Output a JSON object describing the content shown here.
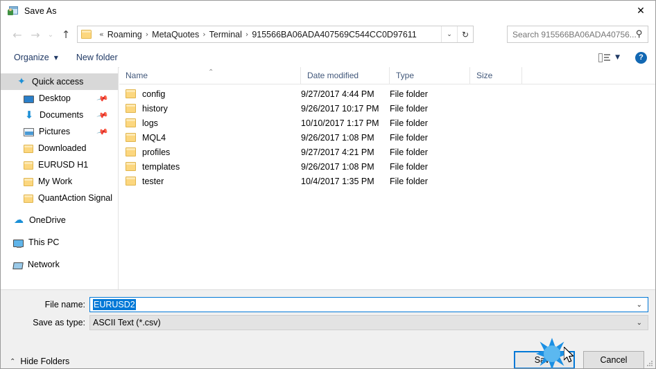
{
  "window": {
    "title": "Save As",
    "app_icon": "save-as-icon",
    "close_label": "✕"
  },
  "nav": {
    "back_label": "←",
    "forward_label": "→",
    "recent_label": "⌄",
    "up_label": "↑"
  },
  "address": {
    "folder_icon": "folder-icon",
    "prefix": "«",
    "crumbs": [
      "Roaming",
      "MetaQuotes",
      "Terminal",
      "915566BA06ADA407569C544CC0D97611"
    ],
    "separator": "›",
    "dropdown_label": "⌄",
    "refresh_label": "↻"
  },
  "search": {
    "placeholder": "Search 915566BA06ADA40756...",
    "icon": "search-icon"
  },
  "toolbar": {
    "organize_label": "Organize",
    "organize_caret": "▼",
    "new_folder_label": "New folder",
    "view_caret": "▼",
    "help_label": "?"
  },
  "sidebar": {
    "items": [
      {
        "label": "Quick access",
        "icon": "star-icon",
        "selected": true,
        "pinned": false,
        "indent": 22
      },
      {
        "label": "Desktop",
        "icon": "desktop-icon",
        "selected": false,
        "pinned": true,
        "indent": 33
      },
      {
        "label": "Documents",
        "icon": "download-arrow-icon",
        "selected": false,
        "pinned": true,
        "indent": 33
      },
      {
        "label": "Pictures",
        "icon": "pictures-icon",
        "selected": false,
        "pinned": true,
        "indent": 33
      },
      {
        "label": "Downloaded",
        "icon": "folder-icon",
        "selected": false,
        "pinned": false,
        "indent": 33
      },
      {
        "label": "EURUSD H1",
        "icon": "folder-icon",
        "selected": false,
        "pinned": false,
        "indent": 33
      },
      {
        "label": "My Work",
        "icon": "folder-icon",
        "selected": false,
        "pinned": false,
        "indent": 33
      },
      {
        "label": "QuantAction Signal",
        "icon": "folder-icon",
        "selected": false,
        "pinned": false,
        "indent": 33
      },
      {
        "label": "OneDrive",
        "icon": "onedrive-icon",
        "selected": false,
        "pinned": false,
        "indent": 18,
        "gap_before": true
      },
      {
        "label": "This PC",
        "icon": "computer-icon",
        "selected": false,
        "pinned": false,
        "indent": 18,
        "gap_before": true
      },
      {
        "label": "Network",
        "icon": "network-icon",
        "selected": false,
        "pinned": false,
        "indent": 18,
        "gap_before": true
      }
    ]
  },
  "filelist": {
    "columns": [
      "Name",
      "Date modified",
      "Type",
      "Size"
    ],
    "sort_caret": "⌃",
    "rows": [
      {
        "name": "config",
        "date": "9/27/2017 4:44 PM",
        "type": "File folder",
        "size": ""
      },
      {
        "name": "history",
        "date": "9/26/2017 10:17 PM",
        "type": "File folder",
        "size": ""
      },
      {
        "name": "logs",
        "date": "10/10/2017 1:17 PM",
        "type": "File folder",
        "size": ""
      },
      {
        "name": "MQL4",
        "date": "9/26/2017 1:08 PM",
        "type": "File folder",
        "size": ""
      },
      {
        "name": "profiles",
        "date": "9/27/2017 4:21 PM",
        "type": "File folder",
        "size": ""
      },
      {
        "name": "templates",
        "date": "9/26/2017 1:08 PM",
        "type": "File folder",
        "size": ""
      },
      {
        "name": "tester",
        "date": "10/4/2017 1:35 PM",
        "type": "File folder",
        "size": ""
      }
    ]
  },
  "footer": {
    "filename_label": "File name:",
    "filename_value": "EURUSD2",
    "filename_arrow": "⌄",
    "savetype_label": "Save as type:",
    "savetype_value": "ASCII Text (*.csv)",
    "savetype_arrow": "⌄",
    "hide_folders_label": "Hide Folders",
    "hide_folders_caret": "⌃",
    "save_label": "Save",
    "cancel_label": "Cancel"
  },
  "colors": {
    "accent": "#0078d7",
    "selection": "#0078d7",
    "folder_yellow": "#fcd77f",
    "header_text": "#41577a",
    "toolbar_text": "#1f3864",
    "panel_bg": "#f0f0f0",
    "sidebar_selected": "#d8d8d8",
    "help_blue": "#1268b3",
    "click_burst": "#1a8fe3"
  }
}
